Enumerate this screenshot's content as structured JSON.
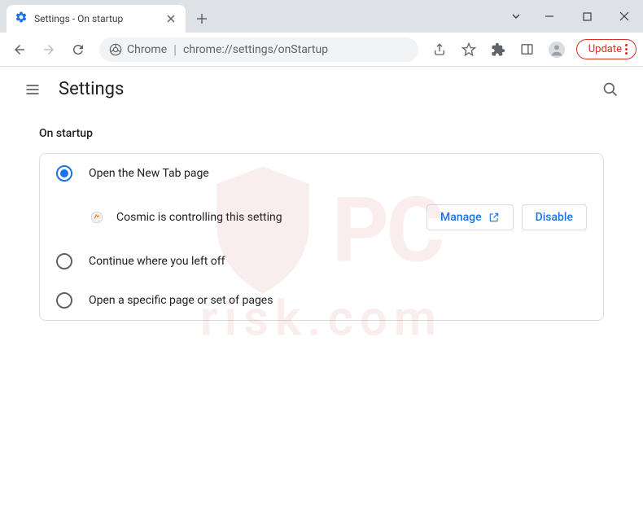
{
  "tab": {
    "title": "Settings - On startup"
  },
  "omnibox": {
    "scheme_label": "Chrome",
    "url": "chrome://settings/onStartup"
  },
  "update_button": {
    "label": "Update"
  },
  "header": {
    "title": "Settings"
  },
  "section": {
    "title": "On startup"
  },
  "options": {
    "newtab": "Open the New Tab page",
    "continue": "Continue where you left off",
    "specific": "Open a specific page or set of pages"
  },
  "extension_notice": {
    "text": "Cosmic is controlling this setting",
    "manage": "Manage",
    "disable": "Disable"
  },
  "watermark": {
    "brand": "PC",
    "sub": "risk.com"
  }
}
